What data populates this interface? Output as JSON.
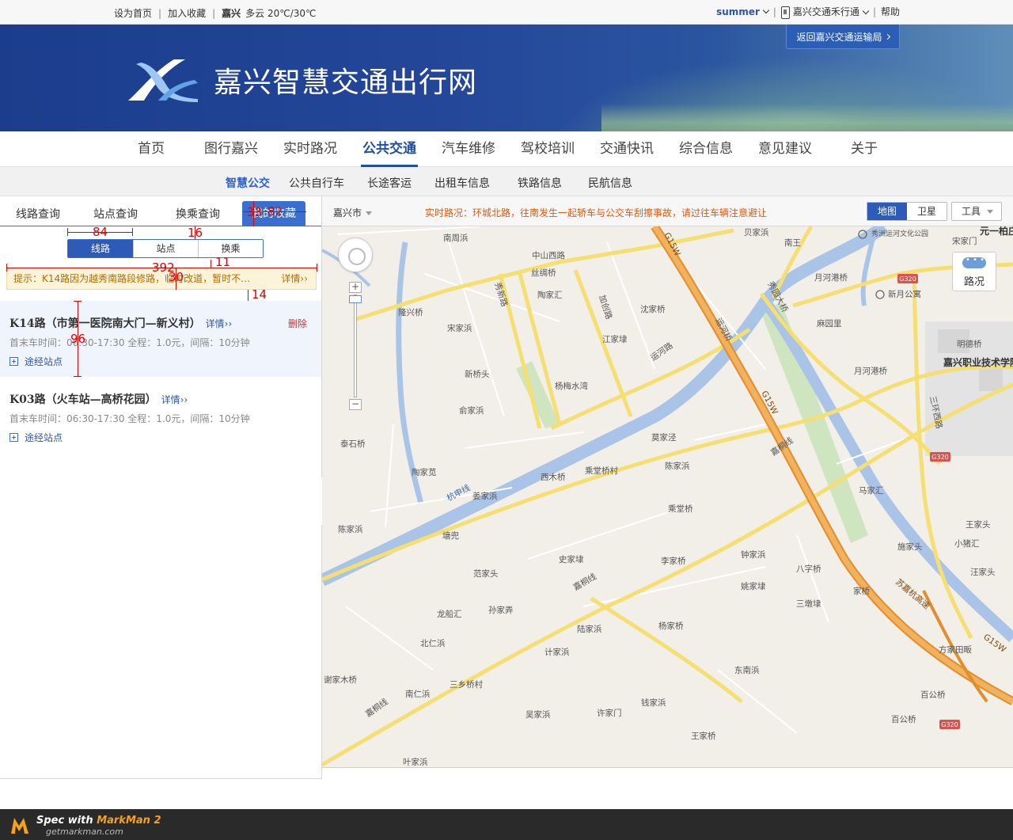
{
  "topbar": {
    "set_home": "设为首页",
    "add_fav": "加入收藏",
    "city": "嘉兴",
    "weather": "多云 20℃/30℃",
    "user": "summer",
    "app": "嘉兴交通禾行通",
    "help": "帮助"
  },
  "banner": {
    "title": "嘉兴智慧交通出行网",
    "return_btn": "返回嘉兴交通运输局"
  },
  "mainnav": {
    "items": [
      "首页",
      "图行嘉兴",
      "实时路况",
      "公共交通",
      "汽车维修",
      "驾校培训",
      "交通快讯",
      "综合信息",
      "意见建议",
      "关于"
    ],
    "active": "公共交通"
  },
  "subnav": {
    "items": [
      "智慧公交",
      "公共自行车",
      "长途客运",
      "出租车信息",
      "铁路信息",
      "民航信息"
    ],
    "active": "智慧公交"
  },
  "leftpanel": {
    "tabs": [
      "线路查询",
      "站点查询",
      "换乘查询",
      "我的收藏"
    ],
    "segments": [
      "线路",
      "站点",
      "换乘"
    ],
    "notice": "提示：K14路因为越秀南路段修路，临时改道，暂时不…",
    "notice_more": "详情",
    "routes": [
      {
        "name": "K14路（市第一医院南大门—新义村）",
        "detail": "详情",
        "delete": "删除",
        "meta": "首末车时间：06:30-17:30 全程：1.0元，间隔：10分钟",
        "stops": "途经站点"
      },
      {
        "name": "K03路（火车站—高桥花园）",
        "detail": "详情",
        "meta": "首末车时间：06:30-17:30 全程：1.0元，间隔：10分钟",
        "stops": "途经站点"
      }
    ]
  },
  "spec": {
    "w84": "84",
    "h16": "16",
    "h33": "33",
    "w82": "82",
    "h11": "11",
    "w392": "392",
    "h30": "30",
    "h14": "14",
    "h96": "96"
  },
  "map": {
    "city": "嘉兴市",
    "traffic": "实时路况：环城北路，往南发生一起轿车与公交车刮擦事故，请过往车辆注意避让",
    "type_map": "地图",
    "type_sat": "卫星",
    "tools": "工具",
    "road_status": "路况",
    "labels": {
      "l1": "南周浜",
      "l2": "中山西路",
      "l3": "丝绸桥",
      "l4": "陶家汇",
      "l5": "隆兴桥",
      "l6": "宋家浜",
      "l7": "秀新路",
      "l8": "加创路",
      "l9": "沈家桥",
      "l10": "江家埭",
      "l11": "新桥头",
      "l12": "杨梅水湾",
      "l13": "俞家浜",
      "l14": "运河桥",
      "l15": "运河路",
      "l16": "G15W",
      "l17": "秀园大桥",
      "l18": "贝家浜",
      "l19": "南王",
      "l20": "月河港桥",
      "l21": "新月公寓",
      "l22": "麻园里",
      "l23": "明德桥",
      "l24": "嘉兴职业技术学院",
      "l25": "月河港桥",
      "l26": "三环西路",
      "l27": "G320",
      "l28": "莫家泾",
      "l29": "泰石桥",
      "l30": "陈家浜",
      "l31": "西木桥",
      "l32": "乘堂桥村",
      "l33": "嘉桐线",
      "l34": "马家汇",
      "l35": "陶家苋",
      "l36": "姜家浜",
      "l37": "杭申线",
      "l38": "乘堂桥",
      "l39": "陈家浜",
      "l40": "塘兜",
      "l41": "史家埭",
      "l42": "李家桥",
      "l43": "钟家浜",
      "l44": "八字桥",
      "l45": "施家头",
      "l46": "王家头",
      "l47": "小猪汇",
      "l48": "汪家头",
      "l49": "范家头",
      "l50": "嘉桐线",
      "l51": "姚家埭",
      "l52": "家桥",
      "l53": "三墩埭",
      "l54": "龙船汇",
      "l55": "孙家弄",
      "l56": "陆家浜",
      "l57": "杨家桥",
      "l58": "北仁浜",
      "l59": "计家浜",
      "l60": "方家田畈",
      "l61": "东南浜",
      "l62": "谢家木桥",
      "l63": "三乡桥村",
      "l64": "南仁浜",
      "l65": "钱家浜",
      "l66": "吴家浜",
      "l67": "许家门",
      "l68": "王家桥",
      "l69": "百公桥",
      "l70": "叶家浜",
      "l71": "嘉桐线",
      "l72": "元一柏庄",
      "l73": "苏嘉杭高速",
      "l74": "G320",
      "l75": "G320",
      "l76": "G320",
      "l77": "宋家门",
      "l78": "秀洲运河文化公园"
    }
  },
  "footer": {
    "brand_prefix": "Spec with ",
    "brand": "MarkMan 2",
    "url": "getmarkman.com"
  }
}
